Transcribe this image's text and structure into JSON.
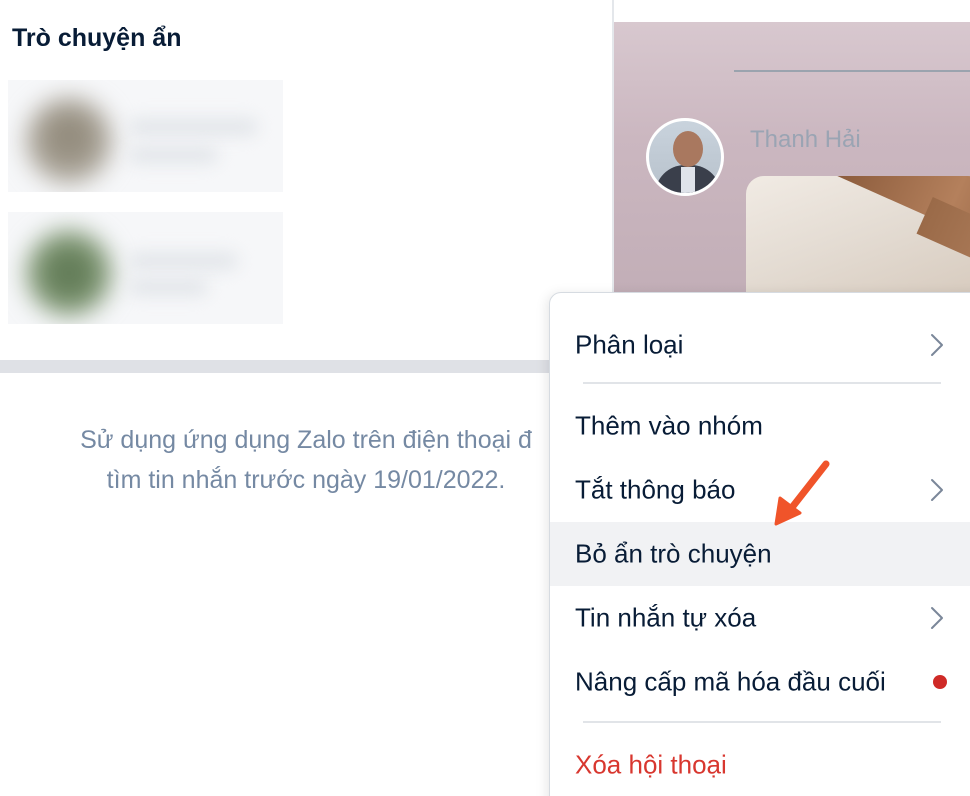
{
  "left_panel": {
    "section_title": "Trò chuyện ẩn",
    "hidden_chats": [
      {
        "name": "",
        "preview": ""
      },
      {
        "name": "",
        "preview": ""
      }
    ],
    "notice_line_1": "Sử dụng ứng dụng Zalo trên điện thoại đ",
    "notice_line_2": "tìm tin nhắn trước ngày 19/01/2022."
  },
  "chat_area": {
    "sender_name": "Thanh Hải"
  },
  "context_menu": {
    "items": [
      {
        "label": "Phân loại",
        "has_submenu": true
      },
      {
        "label": "Thêm vào nhóm",
        "has_submenu": false
      },
      {
        "label": "Tắt thông báo",
        "has_submenu": true
      },
      {
        "label": "Bỏ ẩn trò chuyện",
        "has_submenu": false,
        "highlighted": true
      },
      {
        "label": "Tin nhắn tự xóa",
        "has_submenu": true
      },
      {
        "label": "Nâng cấp mã hóa đầu cuối",
        "has_submenu": false,
        "badge": "red-dot"
      },
      {
        "label": "Xóa hội thoại",
        "has_submenu": false,
        "danger": true
      }
    ]
  },
  "colors": {
    "text_primary": "#081c36",
    "text_muted": "#7589a3",
    "danger": "#d8372f",
    "badge_dot": "#cf2a27",
    "highlight_bg": "#f1f2f4",
    "annotation_arrow": "#f0542a"
  },
  "icons": {
    "submenu": "chevron-right-icon",
    "new_badge": "red-dot-icon",
    "annotation": "arrow-annotation-icon"
  }
}
